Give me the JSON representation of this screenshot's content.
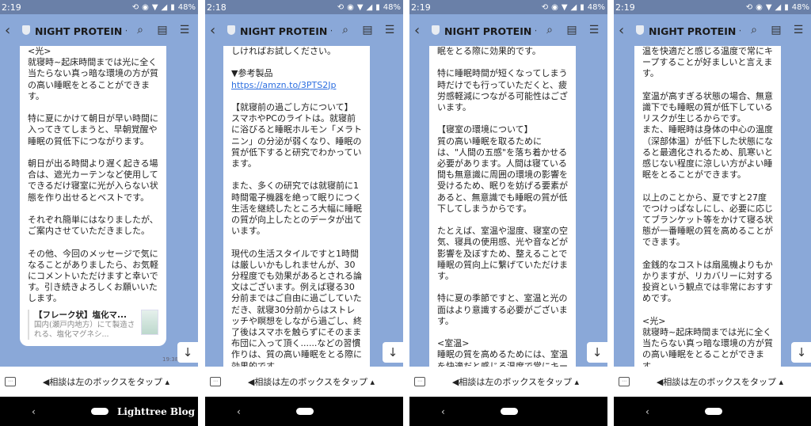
{
  "app": {
    "chat_title": "NIGHT PROTEIN 公...",
    "footer_text": "◀相談は左のボックスをタップ ▴",
    "watermark": "Lighttree Blog",
    "battery": "48%",
    "icons": {
      "back": "chevron-left-icon",
      "search": "search-icon",
      "notes": "notes-icon",
      "menu": "menu-icon",
      "keyboard": "keyboard-icon",
      "scroll_down": "arrow-down-icon"
    }
  },
  "screens": [
    {
      "time": "2:18",
      "message": {
        "lines_before_link": "しければお試しください。\n\n▼参考製品",
        "link": "https://amzn.to/3PTS2Jp",
        "lines_after_link": "\n【就寝前の過ごし方について】\nスマホやPCのライトは。就寝前に浴びると睡眠ホルモン「メラトニン」の分泌が弱くなり、睡眠の質が低下すると研究でわかっています。\n\nまた、多くの研究では就寝前に1時間電子機器を絶って眠りにつく生活を継続したところ大幅に睡眠の質が向上したとのデータが出ています。\n\n現代の生活スタイルですと1時間は厳しいかもしれませんが、30分程度でも効果があるとされる論文はございます。例えば寝る30分前まではご自由に過ごしていただき、就寝30分前からはストレッチや瞑想をしながら過ごし、終了後はスマホを触らずにそのまま布団に入って頂く......などの習慣作りは、質の高い睡眠をとる際に効果的です。\n\n特に睡眠時間が短くなってしま"
      }
    },
    {
      "time": "2:19",
      "message": {
        "text": "眠をとる際に効果的です。\n\n特に睡眠時間が短くなってしまう時だけでも行っていただくと、疲労感軽減につながる可能性はございます。\n\n【寝室の環境について】\n質の高い睡眠を取るためには、\"人間の五感\"を落ち着かせる必要があります。人間は寝ている間も無意識に周囲の環境の影響を受けるため、眠りを妨げる要素があると、無意識でも睡眠の質が低下してしまうからです。\n\nたとえば、室温や湿度、寝室の空気、寝具の使用感、光や音などが影響を及ぼすため、整えることで睡眠の質向上に繋げていただけます。\n\n特に夏の季節ですと、室温と光の面はより意識する必要がございます。\n\n<室温>\n睡眠の質を高めるためには、室温を快適だと感じる温度で常にキープすることが好ましいと言"
      }
    },
    {
      "time": "2:19",
      "message": {
        "text": "温を快適だと感じる温度で常にキープすることが好ましいと言えます。\n\n室温が高すぎる状態の場合、無意識下でも睡眠の質が低下しているリスクが生じるからです。\nまた、睡眠時は身体の中心の温度（深部体温）が低下した状態になると最適化されるため、肌寒いと感じない程度に涼しい方がよい睡眠をとることができます。\n\n以上のことから、夏ですと27度でつけっぱなしにし、必要に応じてブランケット等をかけて寝る状態が一番睡眠の質を高めることができます。\n\n金銭的なコストは扇風機よりもかかりますが、リカバリーに対する投資という観点では非常におすすめです。\n\n<光>\n就寝時~起床時間までは光に全く当たらない真っ暗な環境の方が質の高い睡眠をとることができます。"
      }
    },
    {
      "time": "2:19",
      "message": {
        "text": "<光>\n就寝時~起床時間までは光に全く当たらない真っ暗な環境の方が質の高い睡眠をとることができます。\n\n特に夏にかけて朝日が早い時間に入ってきてしまうと、早朝覚醒や睡眠の質低下につながります。\n\n朝日が出る時間より遅く起きる場合は、遮光カーテンなど使用してできるだけ寝室に光が入らない状態を作り出せるとベストです。\n\nそれぞれ簡単にはなりましたが、ご案内させていただきました。\n\nその他、今回のメッセージで気になることがありましたら、お気軽にコメントいただけますと幸いです。引き続きよろしくお願いいたします。",
        "link_card": {
          "title": "【フレーク状】塩化マ...",
          "description": "国内(瀬戸内地方）にて製造される、塩化マグネシ..."
        },
        "timestamp": "19:38"
      }
    }
  ]
}
